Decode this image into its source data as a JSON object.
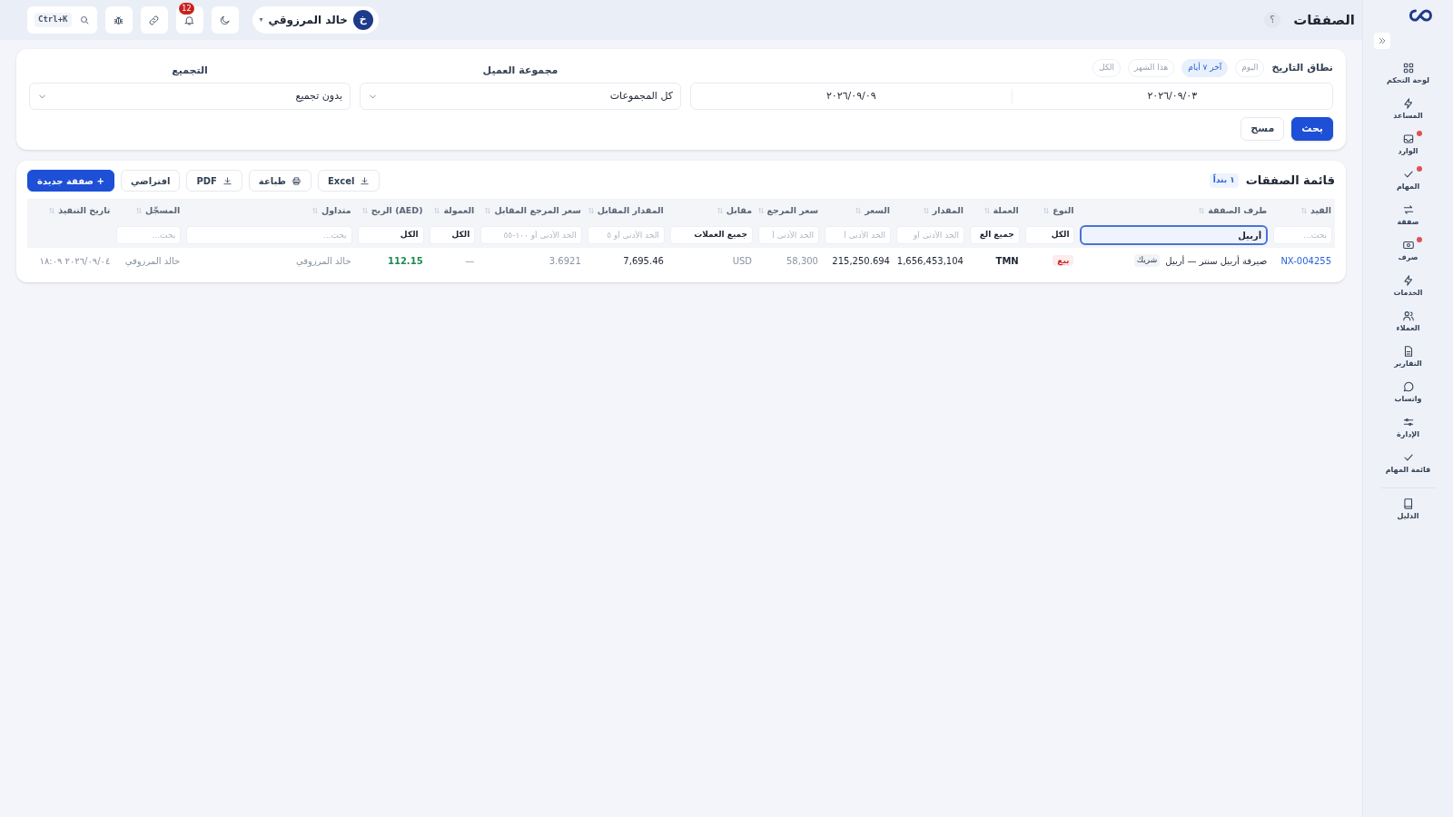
{
  "header": {
    "title": "الصفقات",
    "help": "؟",
    "search_shortcut": "Ctrl+K",
    "notifications": "12",
    "user": {
      "initial": "خ",
      "name": "خالد المرزوقي",
      "caret": "▾"
    }
  },
  "sidebar": {
    "items": [
      {
        "label": "لوحة التحكم",
        "dot": false
      },
      {
        "label": "المساعد",
        "dot": false
      },
      {
        "label": "الوارد",
        "dot": true
      },
      {
        "label": "المهام",
        "dot": true
      },
      {
        "label": "صفقة",
        "dot": false
      },
      {
        "label": "صرف",
        "dot": true
      },
      {
        "label": "الخدمات",
        "dot": false
      },
      {
        "label": "العملاء",
        "dot": false
      },
      {
        "label": "التقارير",
        "dot": false
      },
      {
        "label": "واتساب",
        "dot": false
      },
      {
        "label": "الإدارة",
        "dot": false
      },
      {
        "label": "قائمة المهام",
        "dot": false
      }
    ],
    "footer": {
      "label": "الدليل"
    }
  },
  "filters": {
    "date_range": {
      "label": "نطاق التاريخ",
      "presets": [
        {
          "label": "اليوم",
          "selected": false
        },
        {
          "label": "آخر ٧ أيام",
          "selected": true
        },
        {
          "label": "هذا الشهر",
          "selected": false
        },
        {
          "label": "الكل",
          "selected": false
        }
      ],
      "from": "٢٠٢٦/٠٩/٠٣",
      "to": "٢٠٢٦/٠٩/٠٩"
    },
    "client_group": {
      "label": "مجموعة العميل",
      "value": "كل المجموعات"
    },
    "grouping": {
      "label": "التجميع",
      "value": "بدون تجميع"
    },
    "buttons": [
      {
        "label": "بحث",
        "kind": "primary"
      },
      {
        "label": "مسح",
        "kind": "secondary"
      }
    ]
  },
  "table": {
    "title": "قائمة الصفقات",
    "count": "١ بنداً",
    "actions": [
      {
        "label": "Excel",
        "kind": "secondary"
      },
      {
        "label": "طباعة",
        "kind": "secondary"
      },
      {
        "label": "PDF",
        "kind": "secondary"
      },
      {
        "label": "افتراضي",
        "kind": "secondary"
      },
      {
        "label": "+ صفقة جديدة",
        "kind": "primary"
      }
    ],
    "columns": [
      {
        "label": "القيد",
        "filter": {
          "kind": "search",
          "placeholder": "بحث..."
        }
      },
      {
        "label": "طرف الصفقة",
        "filter": {
          "kind": "text",
          "value": "أربيل"
        }
      },
      {
        "label": "النوع",
        "filter": {
          "kind": "select",
          "value": "الكل"
        }
      },
      {
        "label": "العملة",
        "filter": {
          "kind": "select",
          "value": "جميع الع"
        }
      },
      {
        "label": "المقدار",
        "filter": {
          "kind": "search",
          "placeholder": "الحد الأدنى أو"
        }
      },
      {
        "label": "السعر",
        "filter": {
          "kind": "search",
          "placeholder": "الحد الأدنى أ"
        }
      },
      {
        "label": "سعر المرجع",
        "filter": {
          "kind": "search",
          "placeholder": "الحد الأدنى أ"
        }
      },
      {
        "label": "مقابل",
        "filter": {
          "kind": "select",
          "value": "جميع العملات"
        }
      },
      {
        "label": "المقدار المقابل",
        "filter": {
          "kind": "search",
          "placeholder": "الحد الأدنى أو ٥"
        }
      },
      {
        "label": "سعر المرجع المقابل",
        "filter": {
          "kind": "search",
          "placeholder": "الحد الأدنى أو ١٠٠-٥٥"
        }
      },
      {
        "label": "العمولة",
        "filter": {
          "kind": "select",
          "value": "الكل"
        }
      },
      {
        "label": "(AED) الربح",
        "filter": {
          "kind": "select",
          "value": "الكل"
        }
      },
      {
        "label": "متداول",
        "filter": {
          "kind": "search",
          "placeholder": "بحث..."
        }
      },
      {
        "label": "المسجّل",
        "filter": {
          "kind": "search",
          "placeholder": "بحث..."
        }
      },
      {
        "label": "تاريخ التنفيذ",
        "filter": {
          "kind": "none"
        }
      }
    ],
    "rows": [
      {
        "cells": [
          {
            "kind": "link",
            "text": "NX-004255"
          },
          {
            "kind": "party",
            "text": "صيرفة أربيل سنتر — أربيل",
            "tag": "شريك"
          },
          {
            "kind": "sell",
            "text": "بيع"
          },
          {
            "kind": "strong",
            "text": "TMN"
          },
          {
            "kind": "number",
            "text": "1,656,453,104"
          },
          {
            "kind": "number",
            "text": "215,250.694"
          },
          {
            "kind": "muted",
            "text": "58,300"
          },
          {
            "kind": "muted",
            "text": "USD"
          },
          {
            "kind": "number",
            "text": "7,695.46"
          },
          {
            "kind": "muted",
            "text": "3.6921"
          },
          {
            "kind": "muted",
            "text": "—"
          },
          {
            "kind": "profit",
            "text": "112.15"
          },
          {
            "kind": "muted",
            "text": "خالد المرزوقي"
          },
          {
            "kind": "muted",
            "text": "خالد المرزوقي"
          },
          {
            "kind": "muted",
            "text": "٢٠٢٦/٠٩/٠٤ ١٨:٠٩"
          }
        ]
      }
    ]
  }
}
